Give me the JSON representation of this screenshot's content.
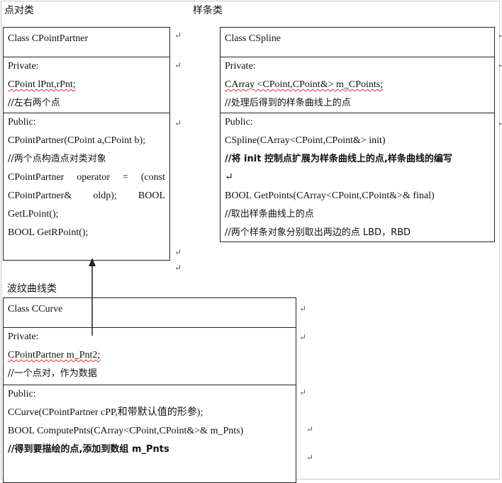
{
  "titles": {
    "point_class": "点对类",
    "spline_class": "样条类",
    "curve_class": "波纹曲线类"
  },
  "point_partner": {
    "header": "Class CPointPartner",
    "private_label": "Private:",
    "private_fields": [
      "CPoint lPnt,rPnt;",
      "//左右两个点"
    ],
    "public_label": "Public:",
    "ctor": "CPointPartner(CPoint a,CPoint b);",
    "ctor_comment": "//两个点构造点对类对象",
    "operator_line": "CPointPartner  operator  =  (const CPointPartner&   oldp);   BOOL GetLPoint();",
    "get_right": "BOOL GetRPoint();"
  },
  "spline": {
    "header": "Class CSpline",
    "private_label": "Private:",
    "private_field": "CArray <CPoint,CPoint&> m_CPoints;",
    "private_comment": "//处理后得到的样条曲线上的点",
    "public_label": "Public:",
    "ctor": "CSpline(CArray<CPoint,CPoint&> init)",
    "ctor_comment": "//将 init 控制点扩展为样条曲线上的点,样条曲线的编写",
    "get_points": "BOOL GetPoints(CArray<CPoint,CPoint&>& final)",
    "get_comment": "//取出样条曲线上的点",
    "lbd_comment": "//两个样条对象分别取出两边的点 LBD，RBD"
  },
  "curve": {
    "header": "Class CCurve",
    "private_label": "Private:",
    "private_field": "CPointPartner m_Pnt2;",
    "private_comment": "//一个点对，作为数据",
    "public_label": "Public:",
    "ctor": "CCurve(CPointPartner cPP,和带默认值的形参);",
    "compute": "BOOL ComputePnts(CArray<CPoint,CPoint&>& m_Pnts)",
    "compute_comment": "//得到要描绘的点,添加到数组 m_Pnts"
  },
  "marks": {
    "para": "↵",
    "cell": "↵"
  }
}
